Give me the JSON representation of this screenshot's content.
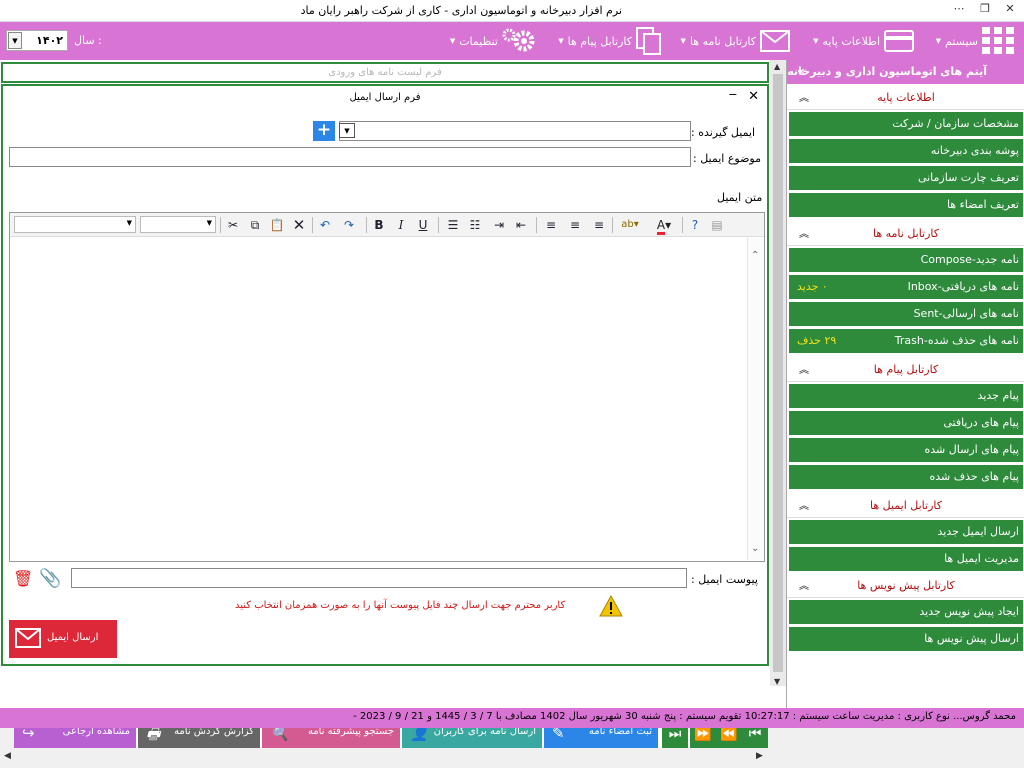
{
  "window": {
    "title": "نرم افزار دبیرخانه و اتوماسیون اداری - کاری از شرکت راهبر رایان ماد",
    "menu_icon": "ellipsis-icon",
    "restore_icon": "restore-icon",
    "close_icon": "close-icon"
  },
  "toolbar": {
    "system_label": "سیستم",
    "base_info_label": "اطلاعات پایه",
    "letters_label": "کارتابل نامه ها",
    "messages_label": "کارتابل پیام ها",
    "settings_label": "تنظیمات",
    "year_label": "سال :",
    "year_value": "۱۴۰۲"
  },
  "login_form_title": "فرم لیست نامه های ورودی",
  "email_form": {
    "title": "فرم ارسال ایمیل",
    "recipient_label": "ایمیل گیرنده :",
    "subject_label": "موضوع ایمیل :",
    "body_label": "متن ایمیل",
    "attachment_label": "پیوست ایمیل :",
    "warning_text": "کاربر محترم جهت ارسال چند فایل پیوست آنها را به صورت همزمان انتخاب کنید",
    "send_label": "ارسال ایمیل",
    "add_label": "+"
  },
  "sidebar": {
    "title": "آیتم های اتوماسیون اداری و دبیرخانه",
    "collapse_icon": "double-chevron-right-icon",
    "sections": [
      {
        "title": "اطلاعات پایه",
        "items": [
          {
            "label": "مشخصات سازمان / شرکت"
          },
          {
            "label": "پوشه بندی دبیرخانه"
          },
          {
            "label": "تعریف چارت سازمانی"
          },
          {
            "label": "تعریف امضاء ها"
          }
        ]
      },
      {
        "title": "کارتابل نامه ها",
        "items": [
          {
            "label": "نامه جدید-Compose"
          },
          {
            "label": "نامه های دریافتی-Inbox",
            "badge": "۰  جدید"
          },
          {
            "label": "نامه های ارسالی-Sent"
          },
          {
            "label": "نامه های حذف شده-Trash",
            "badge": "۲۹  حذف"
          }
        ]
      },
      {
        "title": "کارتابل پیام ها",
        "items": [
          {
            "label": "پیام جدید"
          },
          {
            "label": "پیام های دریافتی"
          },
          {
            "label": "پیام های ارسال شده"
          },
          {
            "label": "پیام های حذف شده"
          }
        ]
      },
      {
        "title": "کارتابل ایمیل ها",
        "items": [
          {
            "label": "ارسال ایمیل جدید"
          },
          {
            "label": "مدیریت ایمیل ها"
          }
        ]
      },
      {
        "title": "کارتابل پیش نویس ها",
        "items": [
          {
            "label": "ایجاد پیش نویس جدید"
          },
          {
            "label": "ارسال پیش نویس ها"
          }
        ]
      }
    ]
  },
  "bottom_nav": {
    "sign": "ثبت امضاء نامه",
    "send_to_users": "ارسال نامه برای کاربران",
    "advanced_search": "جستجو پیشرفته نامه",
    "circulation_report": "گزارش گردش نامه",
    "view_referral": "مشاهده ارجاعی"
  },
  "statusbar": {
    "text": "محمد گروس...  نوع کاربری :  مدیریت    ساعت سیستم :  10:27:17   تقویم سیستم :  پنج شنبه  30  شهریور  سال  1402  مصادف با  7 / 3 / 1445  و  21 / 9 / 2023 -"
  },
  "colors": {
    "accent": "#d874d4",
    "green": "#2e8b3c",
    "danger": "#dc2839",
    "nav_blue": "#2b86e8",
    "nav_teal": "#3aa8a0",
    "nav_pink": "#d45a92",
    "nav_gray": "#666666",
    "nav_purple": "#b85fd1"
  }
}
